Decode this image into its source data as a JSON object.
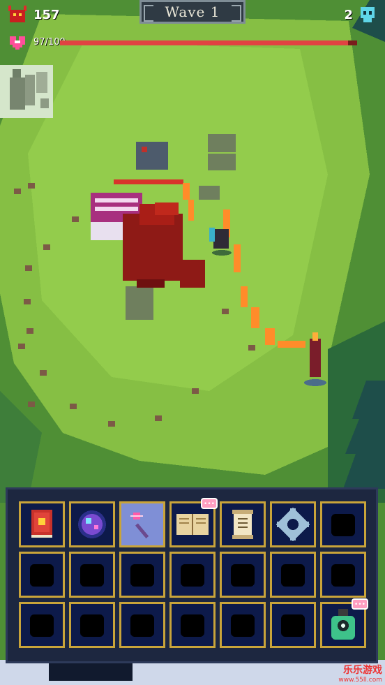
{
  "hud": {
    "kills": "157",
    "wave_label": "Wave 1",
    "skulls": "2",
    "health_text": "97/100",
    "health_fraction": 0.97
  },
  "inventory": {
    "rows": [
      [
        {
          "name": "spellbook-fire",
          "icon": "book-red",
          "selected": false,
          "badge": false
        },
        {
          "name": "crystal-orb",
          "icon": "orb",
          "selected": false,
          "badge": false
        },
        {
          "name": "magic-wand",
          "icon": "wand",
          "selected": true,
          "badge": false
        },
        {
          "name": "open-tome",
          "icon": "tome",
          "selected": false,
          "badge": true
        },
        {
          "name": "scroll",
          "icon": "scroll",
          "selected": false,
          "badge": false
        },
        {
          "name": "frost-gear",
          "icon": "gear",
          "selected": false,
          "badge": false
        },
        {
          "name": "locked-cloak",
          "icon": "silhouette",
          "selected": false,
          "badge": false
        }
      ],
      [
        {
          "name": "locked-amulet",
          "icon": "silhouette",
          "selected": false,
          "badge": false
        },
        {
          "name": "locked-tablet",
          "icon": "silhouette",
          "selected": false,
          "badge": false
        },
        {
          "name": "locked-vase",
          "icon": "silhouette",
          "selected": false,
          "badge": false
        },
        {
          "name": "locked-staff",
          "icon": "silhouette",
          "selected": false,
          "badge": false
        },
        {
          "name": "locked-rune",
          "icon": "silhouette",
          "selected": false,
          "badge": false
        },
        {
          "name": "locked-pyramid",
          "icon": "silhouette",
          "selected": false,
          "badge": false
        },
        {
          "name": "locked-lantern",
          "icon": "silhouette",
          "selected": false,
          "badge": false
        }
      ],
      [
        {
          "name": "locked-cloak-2",
          "icon": "silhouette",
          "selected": false,
          "badge": false
        },
        {
          "name": "locked-chest",
          "icon": "silhouette",
          "selected": false,
          "badge": false
        },
        {
          "name": "locked-bottle",
          "icon": "silhouette",
          "selected": false,
          "badge": false
        },
        {
          "name": "locked-shield",
          "icon": "silhouette",
          "selected": false,
          "badge": false
        },
        {
          "name": "locked-gravestone",
          "icon": "silhouette",
          "selected": false,
          "badge": false
        },
        {
          "name": "locked-armor",
          "icon": "silhouette",
          "selected": false,
          "badge": false
        },
        {
          "name": "eye-potion",
          "icon": "potion",
          "selected": false,
          "badge": true
        }
      ]
    ]
  },
  "watermark": {
    "cn": "乐乐游戏",
    "url": "www.55ll.com"
  },
  "colors": {
    "grass": "#5a9a3a",
    "grass_light": "#8cc24a",
    "enemy_red": "#8e1a16",
    "health_red": "#e14242",
    "slot_border": "#c9a43a"
  }
}
